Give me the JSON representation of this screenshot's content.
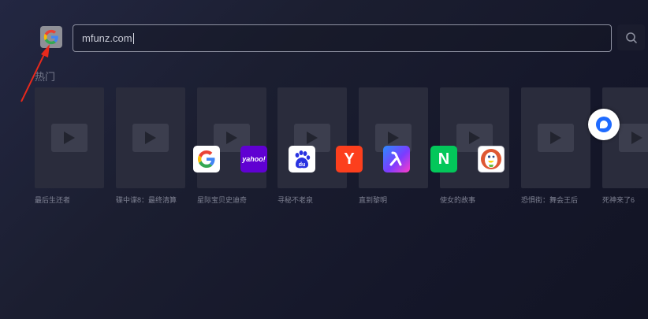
{
  "search": {
    "engine": "google-icon",
    "value": "mfunz.com"
  },
  "hot": {
    "title": "热门",
    "movies": [
      {
        "title": "最后生还者"
      },
      {
        "title": "碟中谍8：最终清算"
      },
      {
        "title": "星际宝贝史迪奇"
      },
      {
        "title": "寻秘不老泉"
      },
      {
        "title": "直到黎明"
      },
      {
        "title": "使女的故事"
      },
      {
        "title": "恐惧街：舞会王后"
      },
      {
        "title": "死神来了6"
      }
    ]
  },
  "engines": [
    {
      "name": "google-icon",
      "label": "G"
    },
    {
      "name": "yahoo-icon",
      "label": "yahoo!"
    },
    {
      "name": "baidu-icon",
      "label": "du"
    },
    {
      "name": "yandex-icon",
      "label": "Y"
    },
    {
      "name": "kuake-icon",
      "label": ""
    },
    {
      "name": "naver-icon",
      "label": "N"
    },
    {
      "name": "duckduckgo-icon",
      "label": ""
    }
  ],
  "colors": {
    "accent": "#1f6bff",
    "annotation_arrow": "#e8291c"
  }
}
